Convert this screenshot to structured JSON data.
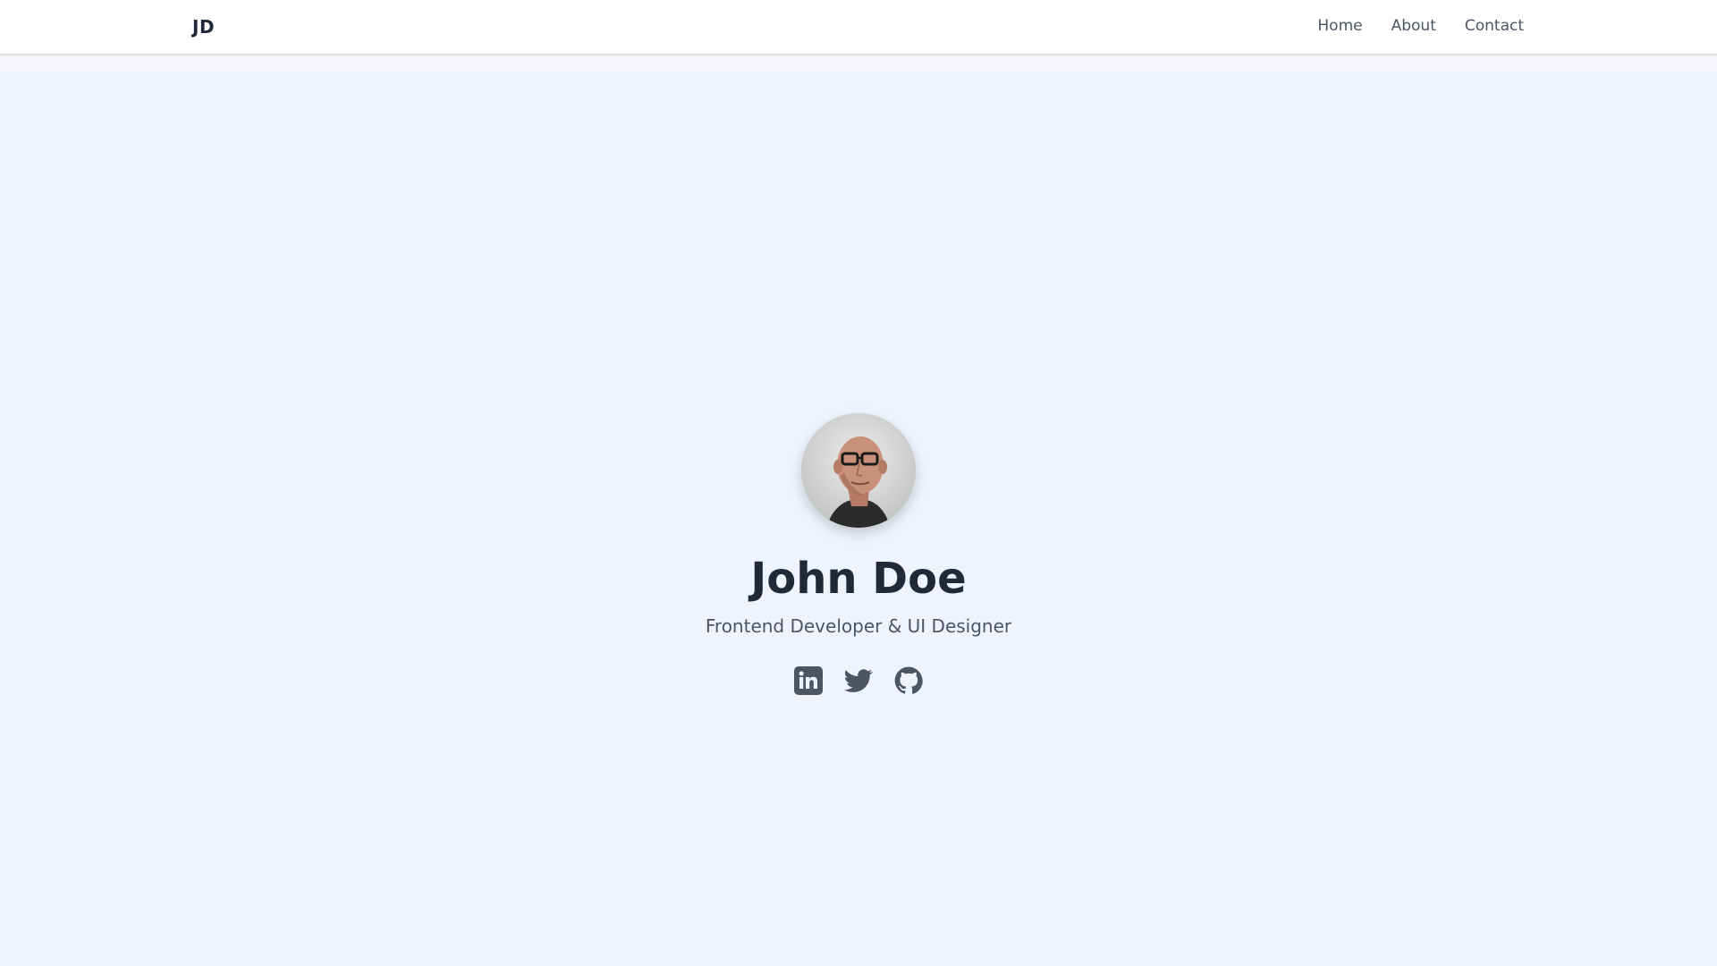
{
  "nav": {
    "brand": "JD",
    "links": [
      "Home",
      "About",
      "Contact"
    ]
  },
  "hero": {
    "name": "John Doe",
    "tagline": "Frontend Developer & UI Designer",
    "avatar_alt": "profile photo"
  },
  "social": {
    "icons": [
      "linkedin-icon",
      "twitter-icon",
      "github-icon"
    ]
  },
  "colors": {
    "nav_bg": "#ffffff",
    "hero_bg": "#eef3fd",
    "text_dark": "#1f2937",
    "text_muted": "#4b5563",
    "icon": "#4b5563"
  }
}
